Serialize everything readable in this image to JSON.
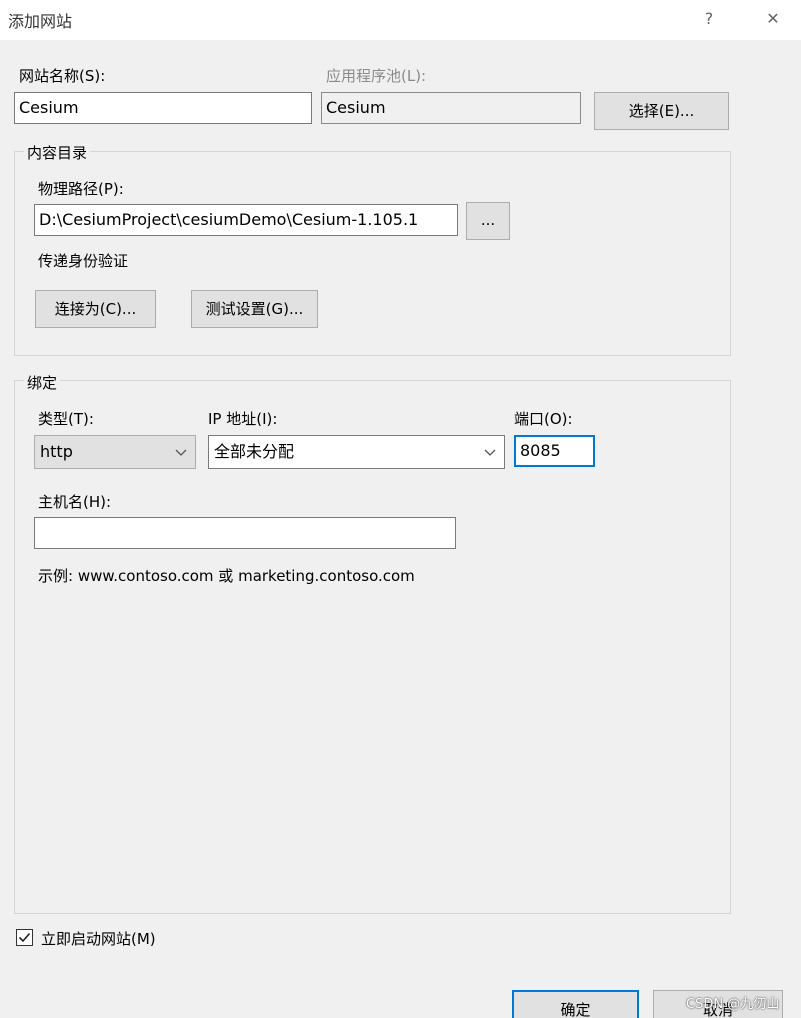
{
  "window": {
    "title": "添加网站",
    "help_glyph": "?",
    "close_glyph": "✕"
  },
  "site_name": {
    "label": "网站名称(S):",
    "value": "Cesium"
  },
  "app_pool": {
    "label": "应用程序池(L):",
    "value": "Cesium",
    "select_label": "选择(E)..."
  },
  "content_dir": {
    "group_title": "内容目录",
    "physical_path_label": "物理路径(P):",
    "physical_path_value": "D:\\CesiumProject\\cesiumDemo\\Cesium-1.105.1",
    "browse_label": "...",
    "passthrough_label": "传递身份验证",
    "connect_as_label": "连接为(C)...",
    "test_settings_label": "测试设置(G)..."
  },
  "binding": {
    "group_title": "绑定",
    "type_label": "类型(T):",
    "type_value": "http",
    "ip_label": "IP 地址(I):",
    "ip_value": "全部未分配",
    "port_label": "端口(O):",
    "port_value": "8085",
    "hostname_label": "主机名(H):",
    "hostname_value": "",
    "example_text": "示例: www.contoso.com 或 marketing.contoso.com"
  },
  "start_site": {
    "label": "立即启动网站(M)",
    "checked": true,
    "check_glyph": "✓"
  },
  "footer": {
    "ok_label": "确定",
    "cancel_label": "取消"
  },
  "watermark": "CSDN @九仞山",
  "colors": {
    "focus_blue": "#0078d7",
    "dialog_bg": "#f0f0f0",
    "button_bg": "#e1e1e1"
  }
}
